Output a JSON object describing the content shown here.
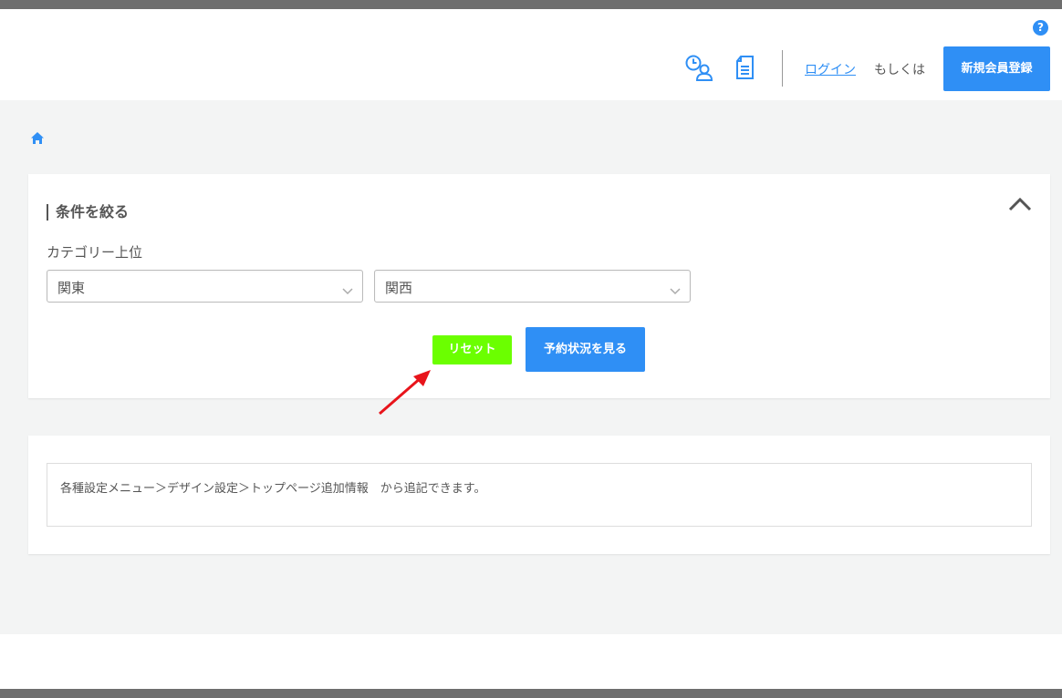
{
  "header": {
    "help_icon": "question-circle-icon",
    "help_glyph": "?",
    "history_icon": "clock-user-icon",
    "document_icon": "document-icon",
    "login_label": "ログイン",
    "or_text": "もしくは",
    "register_label": "新規会員登録"
  },
  "breadcrumb": {
    "home_icon": "home-icon"
  },
  "filter_panel": {
    "title": "条件を絞る",
    "category_label": "カテゴリー上位",
    "select_1_value": "関東",
    "select_2_value": "関西",
    "reset_label": "リセット",
    "view_label": "予約状況を見る"
  },
  "info_panel": {
    "text": "各種設定メニュー＞デザイン設定＞トップページ追加情報　から追記できます。"
  },
  "colors": {
    "accent": "#2f8ff5",
    "reset_button": "#6bff00",
    "annotation_arrow": "#e8141b",
    "background": "#f3f4f4"
  }
}
